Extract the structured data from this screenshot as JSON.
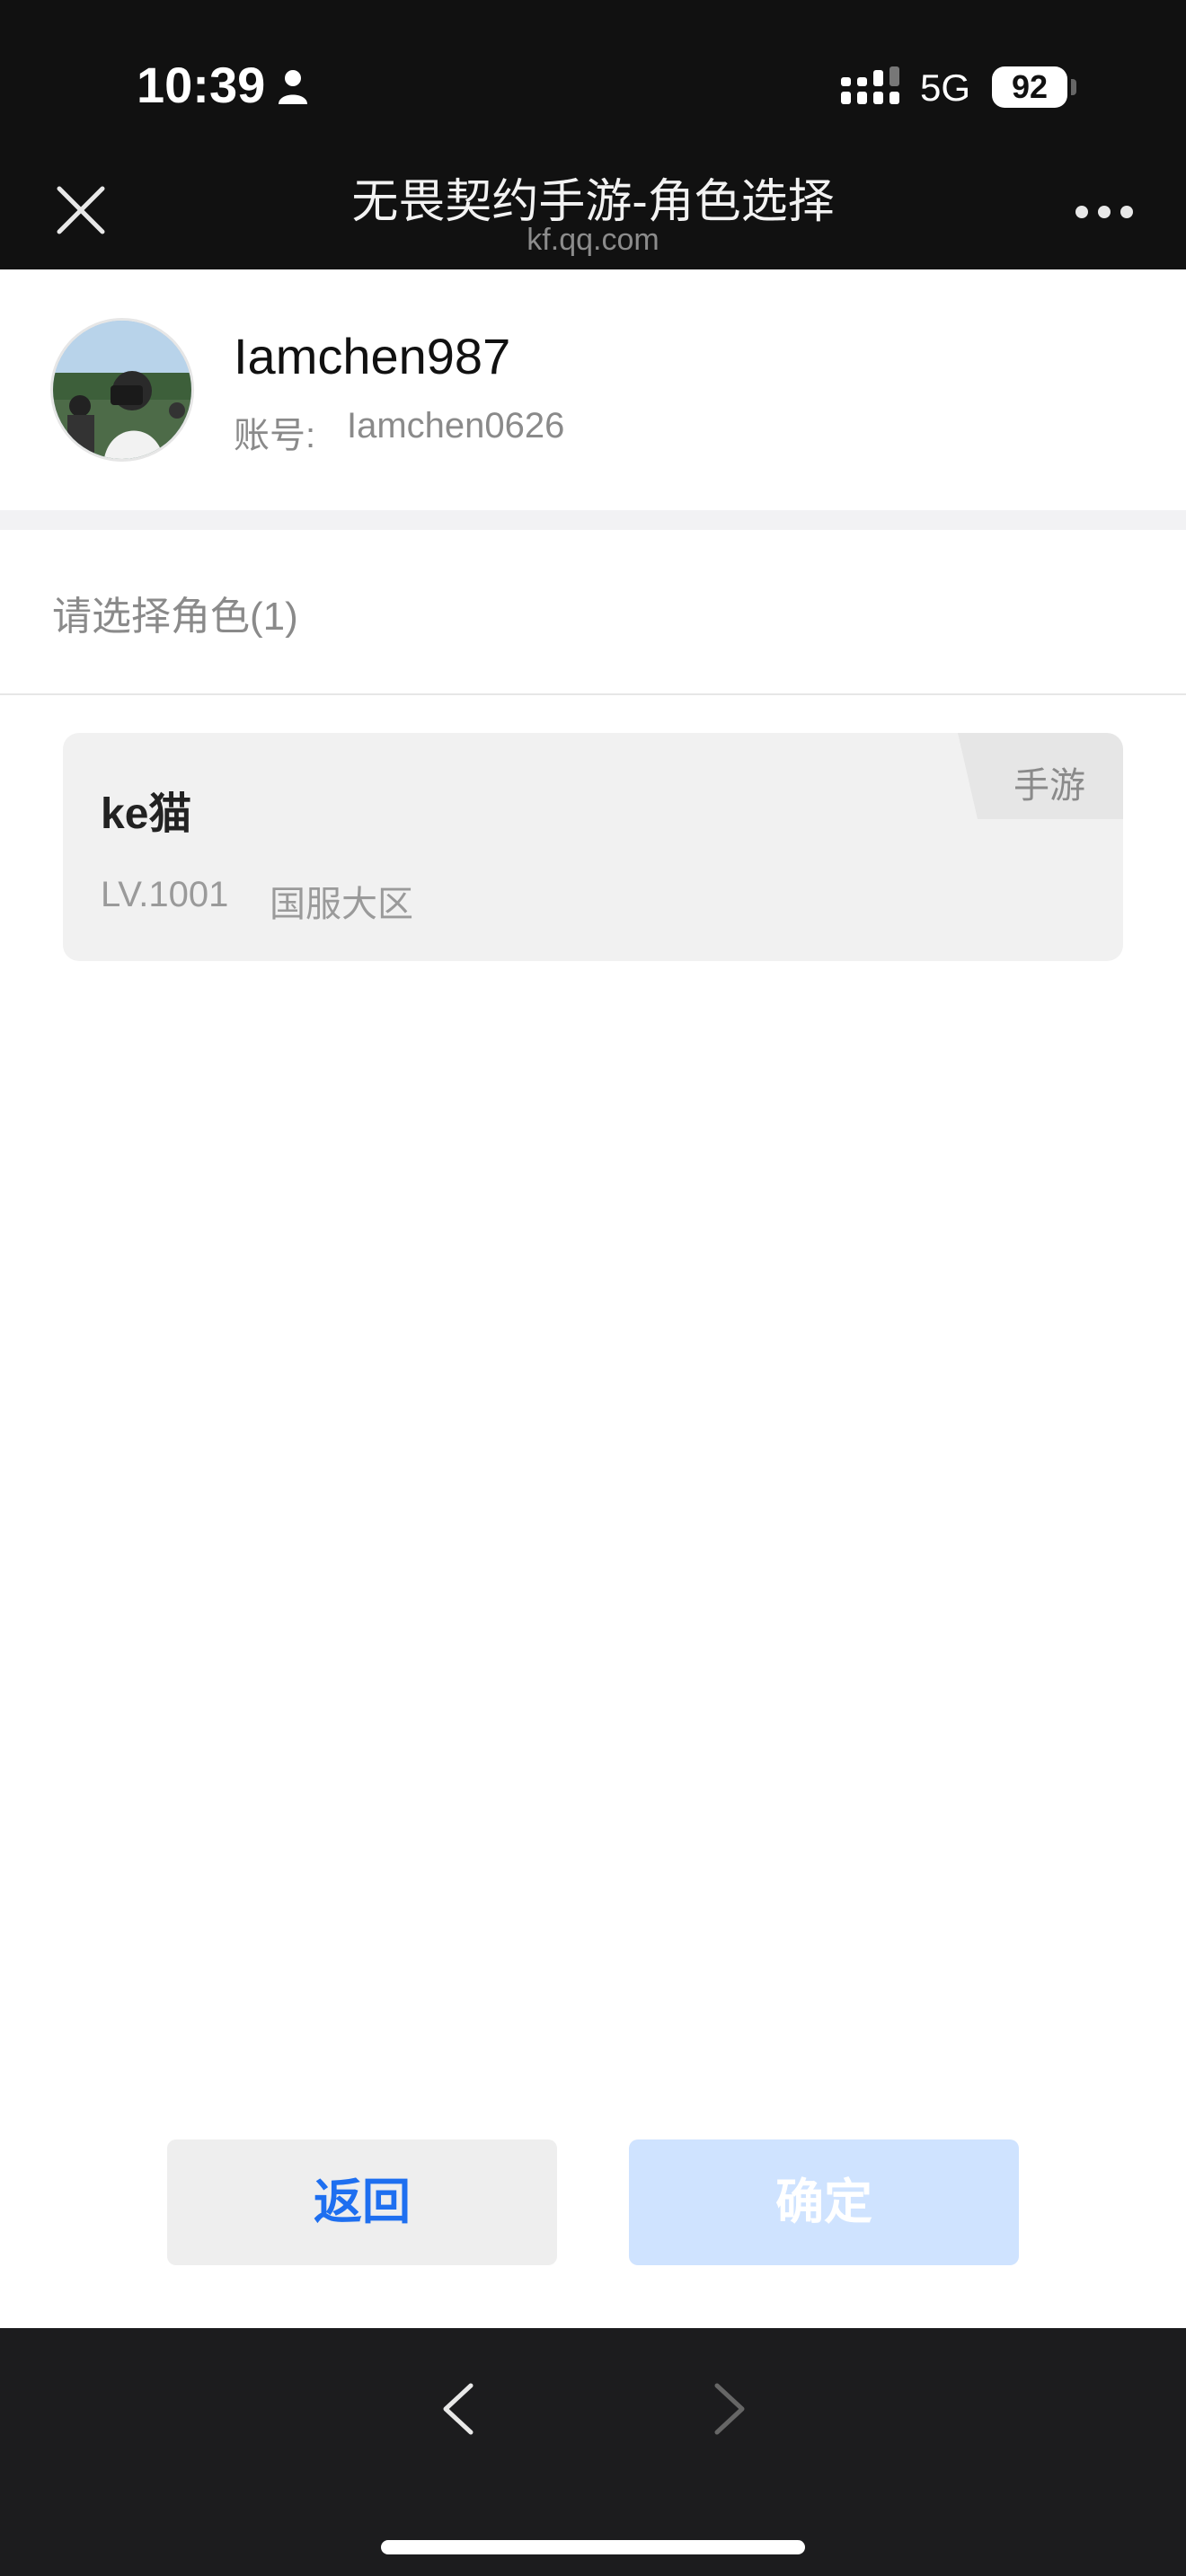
{
  "status_bar": {
    "time": "10:39",
    "network": "5G",
    "battery": "92"
  },
  "nav": {
    "title": "无畏契约手游-角色选择",
    "subtitle": "kf.qq.com"
  },
  "account": {
    "name": "Iamchen987",
    "id_label": "账号:",
    "id_value": "Iamchen0626"
  },
  "role_list": {
    "header": "请选择角色(1)",
    "roles": [
      {
        "name": "ke猫",
        "level": "LV.1001",
        "server": "国服大区",
        "tag": "手游"
      }
    ]
  },
  "buttons": {
    "back": "返回",
    "confirm": "确定"
  },
  "colors": {
    "accent": "#1e6ff0",
    "confirm_disabled_bg": "#cfe3ff",
    "bar_bg": "#111111"
  },
  "icons": {
    "close": "close-icon",
    "more": "more-icon",
    "back": "chevron-left-icon",
    "forward": "chevron-right-icon"
  }
}
